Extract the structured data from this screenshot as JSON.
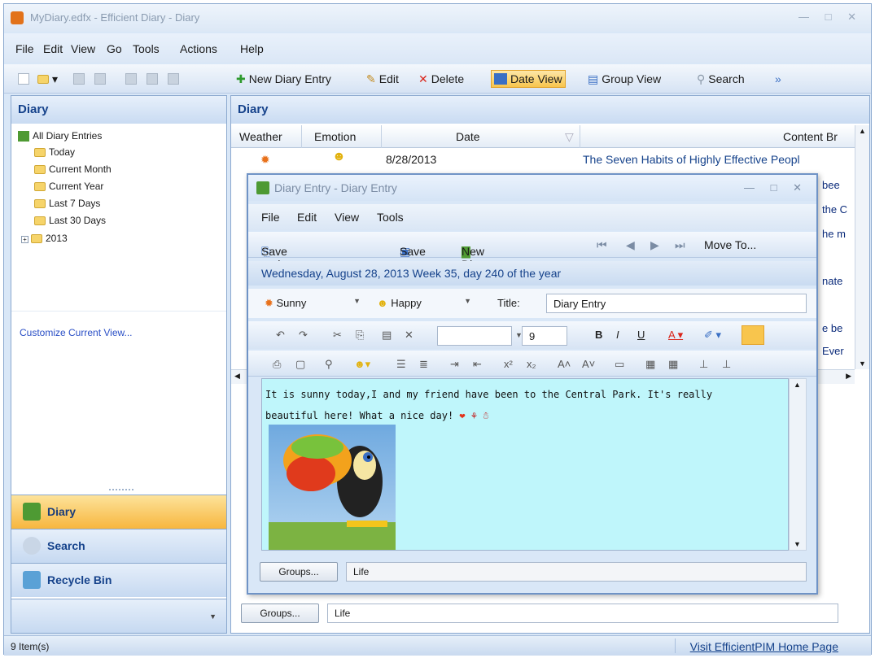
{
  "window": {
    "title": "MyDiary.edfx - Efficient Diary - Diary"
  },
  "menu": {
    "file": "File",
    "edit": "Edit",
    "view": "View",
    "go": "Go",
    "tools": "Tools",
    "actions": "Actions",
    "help": "Help"
  },
  "toolbar": {
    "new_entry": "New Diary Entry",
    "edit": "Edit",
    "delete": "Delete",
    "date_view": "Date View",
    "group_view": "Group View",
    "search": "Search"
  },
  "nav": {
    "header": "Diary",
    "tree": {
      "root": "All Diary Entries",
      "today": "Today",
      "month": "Current Month",
      "year": "Current Year",
      "last7": "Last 7 Days",
      "last30": "Last 30 Days",
      "y2013": "2013"
    },
    "customize": "Customize Current View...",
    "buttons": {
      "diary": "Diary",
      "search": "Search",
      "recycle": "Recycle Bin"
    }
  },
  "main": {
    "header": "Diary",
    "columns": {
      "weather": "Weather",
      "emotion": "Emotion",
      "date": "Date",
      "content": "Content Br"
    },
    "row": {
      "date": "8/28/2013",
      "content": "The Seven Habits of Highly Effective Peopl"
    },
    "peek": {
      "p1": "bee",
      "p2": "the C",
      "p3": "he m",
      "p4": "nate",
      "p5": "e be",
      "p6": "Ever"
    },
    "groups_button": "Groups...",
    "groups_value": "Life"
  },
  "dialog": {
    "title": "Diary Entry - Diary Entry",
    "menu": {
      "file": "File",
      "edit": "Edit",
      "view": "View",
      "tools": "Tools"
    },
    "toolbar": {
      "save_close": "Save and Close",
      "save": "Save",
      "new_entry": "New Diary Entry",
      "move_to": "Move To..."
    },
    "date_line": "Wednesday, August 28, 2013  Week 35, day 240 of the year",
    "weather": "Sunny",
    "emotion": "Happy",
    "title_label": "Title:",
    "title_value": "Diary Entry",
    "font_size": "9",
    "body_line1": "It is sunny today,I and my friend have been to the Central Park. It's really",
    "body_line2": "beautiful here! What a nice day!",
    "groups_button": "Groups...",
    "groups_value": "Life"
  },
  "status": {
    "items": "9 Item(s)",
    "link": "Visit EfficientPIM Home Page"
  },
  "colors": {
    "accent": "#15428b",
    "active_orange": "#f8c54d",
    "editor_bg": "#bff6fb"
  }
}
